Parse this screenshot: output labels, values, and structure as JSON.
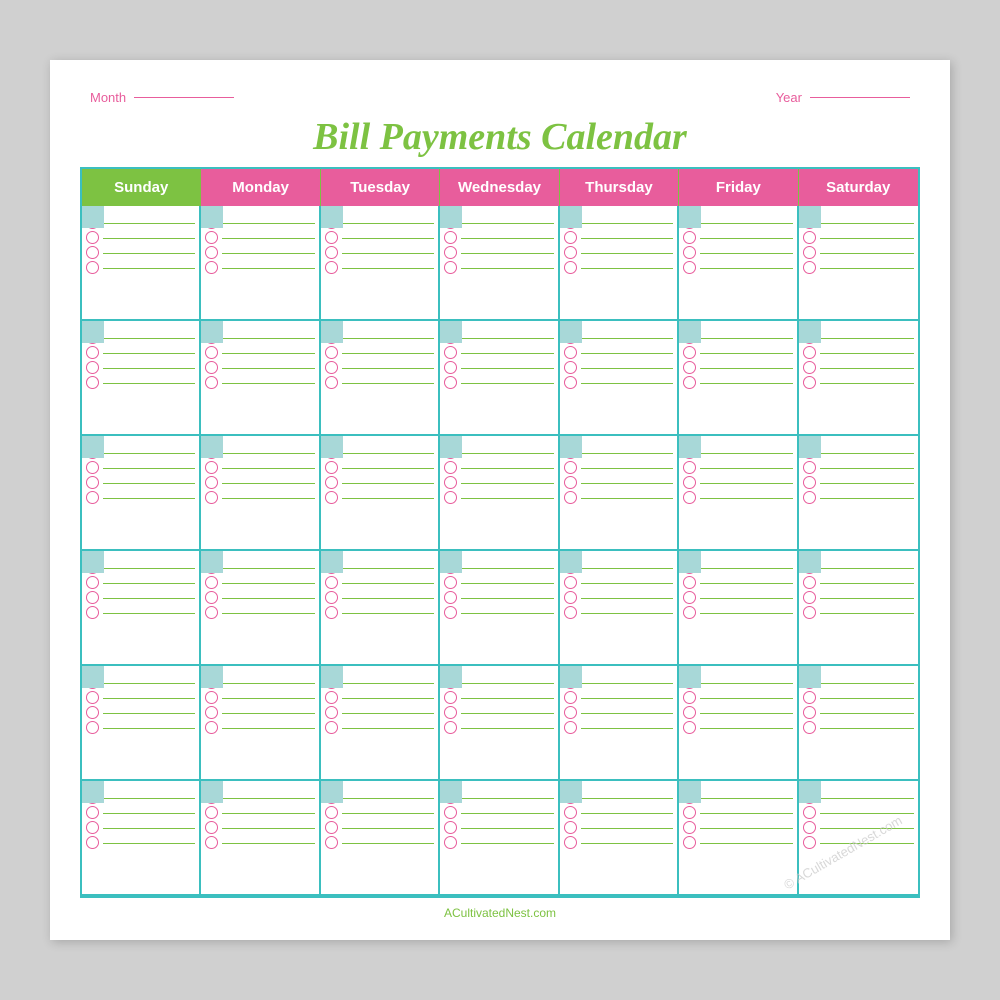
{
  "header": {
    "title": "Bill Payments Calendar",
    "month_label": "Month",
    "year_label": "Year"
  },
  "days": [
    "Sunday",
    "Monday",
    "Tuesday",
    "Wednesday",
    "Thursday",
    "Friday",
    "Saturday"
  ],
  "weeks": 6,
  "items_per_cell": 4,
  "footer": {
    "website": "ACultivatedNest.com",
    "watermark": "ACultivatedNest.com"
  },
  "colors": {
    "green": "#7dc242",
    "pink": "#e85d9c",
    "teal": "#3bbfbf",
    "light_teal": "#a8d8d8"
  }
}
